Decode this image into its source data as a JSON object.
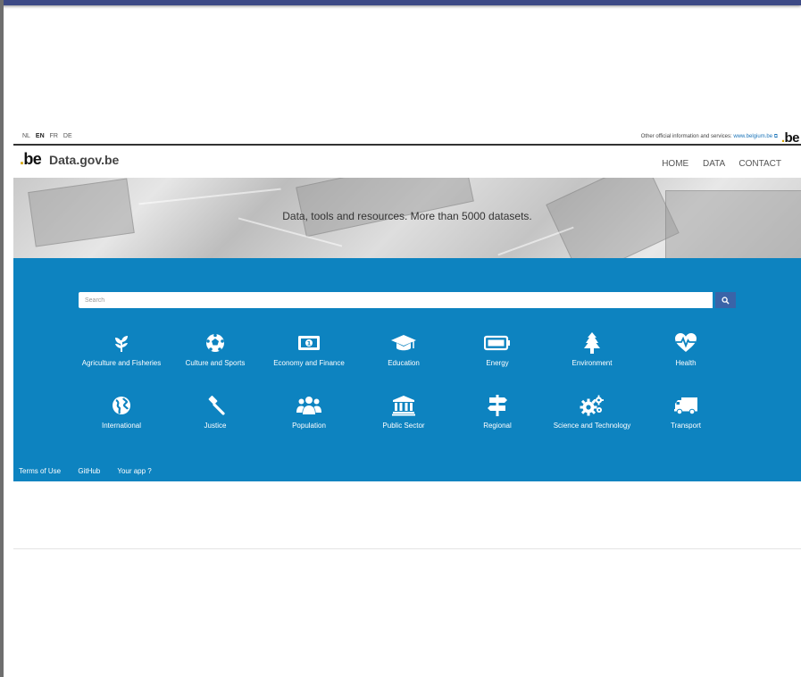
{
  "languages": [
    {
      "code": "NL",
      "active": false
    },
    {
      "code": "EN",
      "active": true
    },
    {
      "code": "FR",
      "active": false
    },
    {
      "code": "DE",
      "active": false
    }
  ],
  "utility": {
    "other_info_text": "Other official information and services:",
    "other_info_link": "www.belgium.be",
    "logo": {
      "dot": ".",
      "text": "be"
    }
  },
  "header": {
    "logo": {
      "dot": ".",
      "text": "be"
    },
    "brand_name": "Data.gov.be",
    "nav": [
      "HOME",
      "DATA",
      "CONTACT"
    ]
  },
  "banner": {
    "text": "Data, tools and resources. More than 5000 datasets."
  },
  "search": {
    "placeholder": "Search",
    "value": ""
  },
  "categories": [
    {
      "label": "Agriculture and Fisheries",
      "icon": "plant-icon"
    },
    {
      "label": "Culture and Sports",
      "icon": "soccer-ball-icon"
    },
    {
      "label": "Economy and Finance",
      "icon": "banknote-icon"
    },
    {
      "label": "Education",
      "icon": "graduation-cap-icon"
    },
    {
      "label": "Energy",
      "icon": "battery-icon"
    },
    {
      "label": "Environment",
      "icon": "tree-icon"
    },
    {
      "label": "Health",
      "icon": "heartbeat-icon"
    },
    {
      "label": "International",
      "icon": "globe-icon"
    },
    {
      "label": "Justice",
      "icon": "gavel-icon"
    },
    {
      "label": "Population",
      "icon": "people-icon"
    },
    {
      "label": "Public Sector",
      "icon": "institution-icon"
    },
    {
      "label": "Regional",
      "icon": "signpost-icon"
    },
    {
      "label": "Science and Technology",
      "icon": "gears-icon"
    },
    {
      "label": "Transport",
      "icon": "truck-icon"
    }
  ],
  "footer": {
    "links": [
      "Terms of Use",
      "GitHub",
      "Your app ?"
    ]
  },
  "colors": {
    "brand_blue": "#0d83c0",
    "search_button": "#3a64a8",
    "logo_dot": "#d4a300"
  }
}
